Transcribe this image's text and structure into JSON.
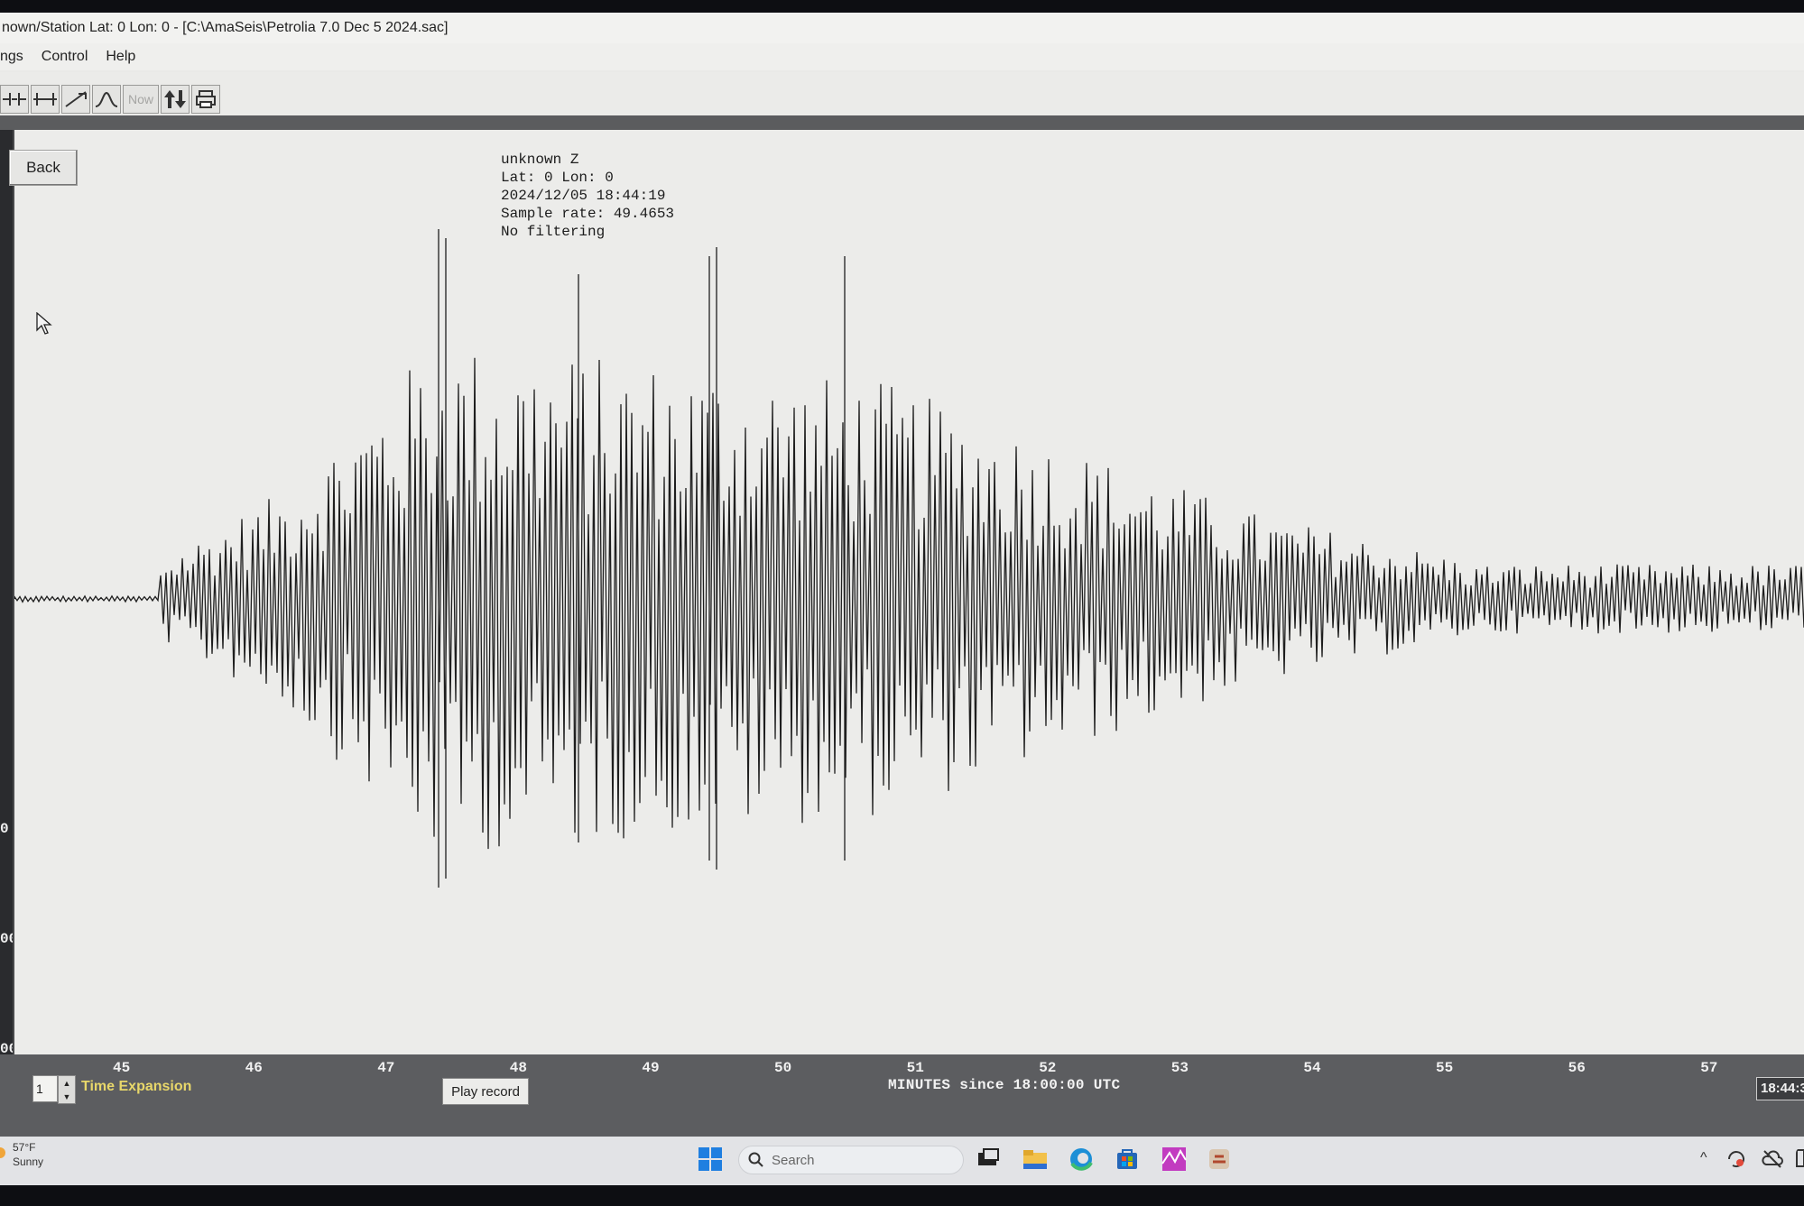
{
  "window": {
    "title": "nown/Station Lat: 0 Lon: 0 - [C:\\AmaSeis\\Petrolia 7.0 Dec 5 2024.sac]"
  },
  "menu": {
    "items": [
      "ngs",
      "Control",
      "Help"
    ]
  },
  "toolbar": {
    "now_label": "Now"
  },
  "back_label": "Back",
  "trace_info": {
    "station": "unknown  Z",
    "location": "Lat: 0 Lon: 0",
    "datetime": "2024/12/05 18:44:19",
    "sample_rate": "Sample rate: 49.4653",
    "filter": "No filtering"
  },
  "y_axis_ticks": [
    "0",
    "00",
    "00"
  ],
  "x_axis": {
    "ticks": [
      "45",
      "46",
      "47",
      "48",
      "49",
      "50",
      "51",
      "52",
      "53",
      "54",
      "55",
      "56",
      "57"
    ],
    "label": "MINUTES since 18:00:00 UTC"
  },
  "controls": {
    "time_expansion_value": "1",
    "time_expansion_label": "Time Expansion",
    "play_label": "Play record",
    "clock": "18:44:3"
  },
  "taskbar": {
    "temp": "57°F",
    "condition": "Sunny",
    "search_placeholder": "Search"
  },
  "colors": {
    "trace": "#1e1e1e",
    "plot_background": "#ececea",
    "frame": "#5c5d60",
    "time_expansion_text": "#e8d76a"
  }
}
